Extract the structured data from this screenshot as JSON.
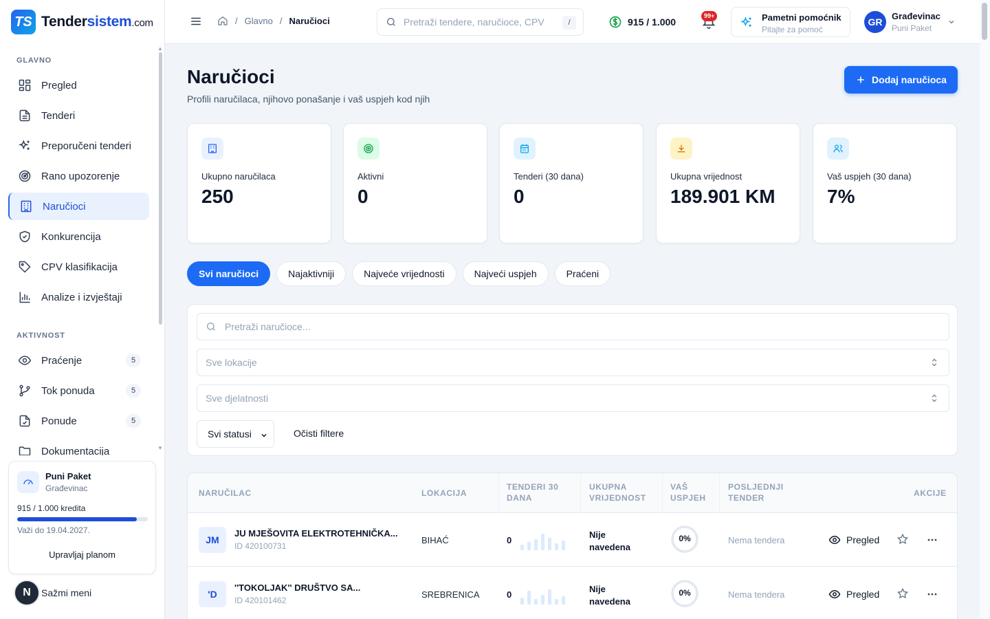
{
  "brand": {
    "mark": "TS",
    "name_pre": "Tender",
    "name_hl": "sistem",
    "name_dom": ".com"
  },
  "sidebar": {
    "section_main": "GLAVNO",
    "main_items": [
      {
        "label": "Pregled",
        "icon": "grid-icon"
      },
      {
        "label": "Tenderi",
        "icon": "document-icon"
      },
      {
        "label": "Preporučeni tenderi",
        "icon": "sparkles-icon"
      },
      {
        "label": "Rano upozorenje",
        "icon": "radar-icon"
      },
      {
        "label": "Naručioci",
        "icon": "building-icon",
        "active": true
      },
      {
        "label": "Konkurencija",
        "icon": "shield-icon"
      },
      {
        "label": "CPV klasifikacija",
        "icon": "tag-icon"
      },
      {
        "label": "Analize i izvještaji",
        "icon": "bar-chart-icon"
      }
    ],
    "section_activity": "AKTIVNOST",
    "activity_items": [
      {
        "label": "Praćenje",
        "icon": "eye-icon",
        "badge": "5"
      },
      {
        "label": "Tok ponuda",
        "icon": "git-branch-icon",
        "badge": "5"
      },
      {
        "label": "Ponude",
        "icon": "file-check-icon",
        "badge": "5"
      },
      {
        "label": "Dokumentacija",
        "icon": "folder-icon"
      }
    ],
    "plan": {
      "title": "Puni Paket",
      "company": "Građevinac",
      "credits": "915 / 1.000 kredita",
      "credits_fraction": 0.915,
      "valid": "Važi do 19.04.2027.",
      "manage": "Upravljaj planom"
    },
    "collapse": {
      "avatar": "N",
      "label": "Sažmi meni"
    }
  },
  "header": {
    "crumb_root": "Glavno",
    "crumb_current": "Naručioci",
    "search_placeholder": "Pretraži tendere, naručioce, CPV",
    "search_kbd": "/",
    "credits": "915 / 1.000",
    "notif_badge": "99+",
    "assistant_title": "Pametni pomoćnik",
    "assistant_sub": "Pitajte za pomoć",
    "user_initials": "GR",
    "user_name": "Građevinac",
    "user_plan": "Puni Paket"
  },
  "page": {
    "title": "Naručioci",
    "subtitle": "Profili naručilaca, njihovo ponašanje i vaš uspjeh kod njih",
    "add_button": "Dodaj naručioca"
  },
  "stats": [
    {
      "label": "Ukupno naručilaca",
      "value": "250",
      "icon": "building-icon",
      "bg": "#eaf1fe",
      "fg": "#2563eb"
    },
    {
      "label": "Aktivni",
      "value": "0",
      "icon": "target-icon",
      "bg": "#dcfce7",
      "fg": "#16a34a"
    },
    {
      "label": "Tenderi (30 dana)",
      "value": "0",
      "icon": "calendar-icon",
      "bg": "#e0f2fe",
      "fg": "#0ea5e9"
    },
    {
      "label": "Ukupna vrijednost",
      "value": "189.901 KM",
      "icon": "download-icon",
      "bg": "#fef3c7",
      "fg": "#d97706"
    },
    {
      "label": "Vaš uspjeh (30 dana)",
      "value": "7%",
      "icon": "users-icon",
      "bg": "#e0f2fe",
      "fg": "#0ea5e9"
    }
  ],
  "tabs": [
    {
      "label": "Svi naručioci",
      "active": true
    },
    {
      "label": "Najaktivniji"
    },
    {
      "label": "Najveće vrijednosti"
    },
    {
      "label": "Najveći uspjeh"
    },
    {
      "label": "Praćeni"
    }
  ],
  "filters": {
    "search_placeholder": "Pretraži naručioce...",
    "location_placeholder": "Sve lokacije",
    "activity_placeholder": "Sve djelatnosti",
    "status_value": "Svi statusi",
    "clear": "Očisti filtere"
  },
  "table": {
    "columns": {
      "buyer": "NARUČILAC",
      "location": "LOKACIJA",
      "tenders_a": "TENDERI 30",
      "tenders_b": "DANA",
      "value_a": "UKUPNA",
      "value_b": "VRIJEDNOST",
      "success_a": "VAŠ",
      "success_b": "USPJEH",
      "last_a": "POSLJEDNJI",
      "last_b": "TENDER",
      "actions": "AKCIJE"
    },
    "rows": [
      {
        "initials": "JM",
        "name": "JU MJEŠOVITA ELEKTROTEHNIČKA...",
        "id": "ID 420100731",
        "location": "BIHAĆ",
        "tenders": "0",
        "value_a": "Nije",
        "value_b": "navedena",
        "success": "0%",
        "last": "Nema tendera",
        "view": "Pregled"
      },
      {
        "initials": "'D",
        "name": "''TOKOLJAK'' DRUŠTVO SA...",
        "id": "ID 420101462",
        "location": "SREBRENICA",
        "tenders": "0",
        "value_a": "Nije",
        "value_b": "navedena",
        "success": "0%",
        "last": "Nema tendera",
        "view": "Pregled"
      }
    ]
  }
}
